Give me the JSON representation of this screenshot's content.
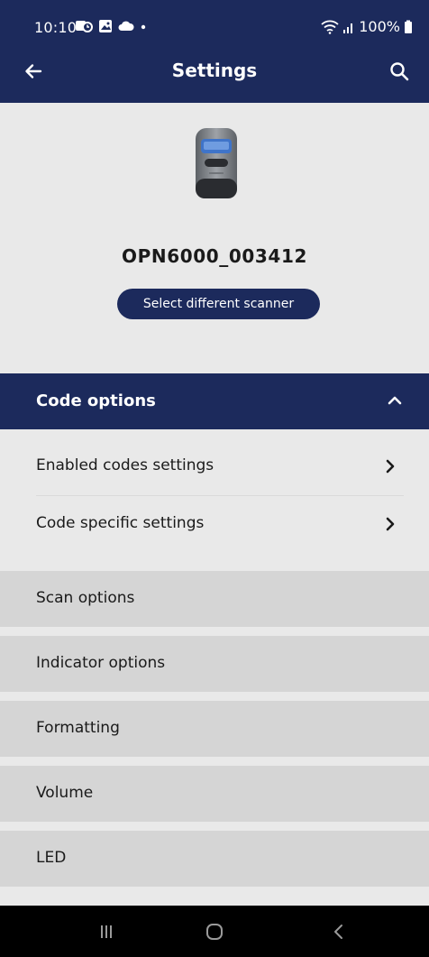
{
  "status_bar": {
    "time": "10:10",
    "battery": "100%",
    "notification_icons": [
      "clock-icon",
      "image-icon",
      "cloud-icon",
      "dot-icon"
    ],
    "system_icons": [
      "wifi-icon",
      "signal-icon",
      "battery-icon"
    ]
  },
  "app_bar": {
    "title": "Settings",
    "back_icon": "arrow-left-icon",
    "search_icon": "search-icon"
  },
  "scanner": {
    "name": "OPN6000_003412",
    "select_button": "Select different scanner"
  },
  "code_options": {
    "title": "Code options",
    "expanded": true,
    "items": [
      {
        "label": "Enabled codes settings"
      },
      {
        "label": "Code specific settings"
      }
    ]
  },
  "collapsed_sections": [
    {
      "label": "Scan options"
    },
    {
      "label": "Indicator options"
    },
    {
      "label": "Formatting"
    },
    {
      "label": "Volume"
    },
    {
      "label": "LED"
    }
  ],
  "colors": {
    "primary": "#1c2a5c",
    "background": "#e9e9e9",
    "collapsed_row": "#d5d5d5"
  },
  "nav_bar": [
    "recent-apps-icon",
    "home-icon",
    "back-icon"
  ]
}
